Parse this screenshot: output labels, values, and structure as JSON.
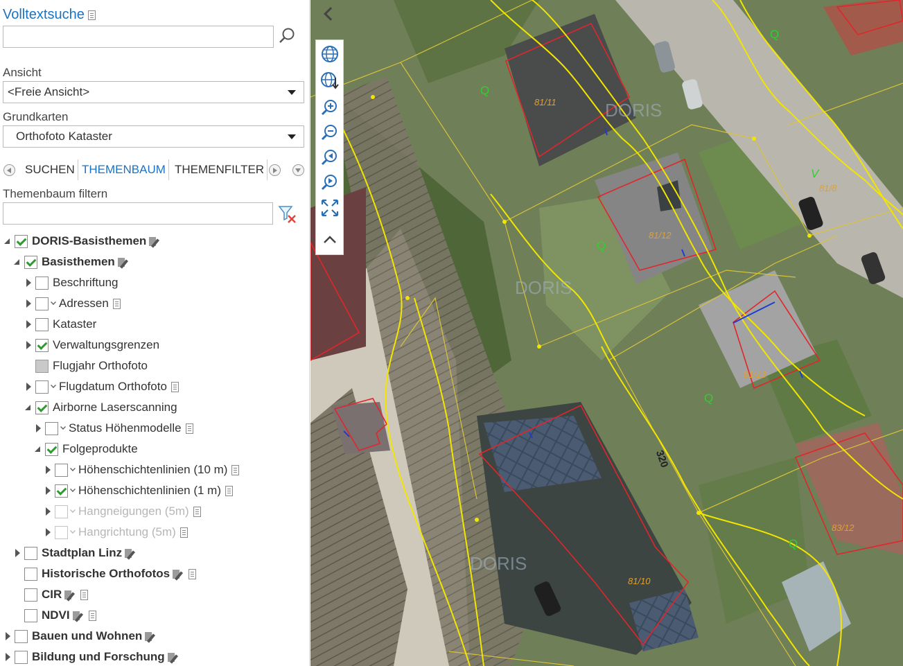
{
  "search": {
    "title": "Volltextsuche",
    "value": "",
    "placeholder": ""
  },
  "view": {
    "label": "Ansicht",
    "selected": "<Freie Ansicht>"
  },
  "basemap": {
    "label": "Grundkarten",
    "selected": "Orthofoto Kataster"
  },
  "tabs": [
    {
      "label": "SUCHEN"
    },
    {
      "label": "THEMENBAUM"
    },
    {
      "label": "THEMENFILTER"
    }
  ],
  "filter": {
    "label": "Themenbaum filtern",
    "value": "",
    "placeholder": ""
  },
  "tree": [
    {
      "label": "DORIS-Basisthemen",
      "bold": true,
      "toggle": "expanded",
      "check": "checked",
      "icons": [
        "edit"
      ]
    },
    {
      "label": "Basisthemen",
      "bold": true,
      "toggle": "expanded",
      "check": "checked",
      "icons": [
        "edit"
      ]
    },
    {
      "label": "Beschriftung",
      "toggle": "collapsed",
      "check": "unchecked",
      "icons": []
    },
    {
      "label": "Adressen",
      "toggle": "collapsed",
      "check": "unchecked",
      "chevron": true,
      "icons": [
        "info"
      ]
    },
    {
      "label": "Kataster",
      "toggle": "collapsed",
      "check": "unchecked",
      "icons": []
    },
    {
      "label": "Verwaltungsgrenzen",
      "toggle": "collapsed",
      "check": "checked",
      "icons": []
    },
    {
      "label": "Flugjahr Orthofoto",
      "toggle": "none",
      "check": "partial",
      "icons": []
    },
    {
      "label": "Flugdatum Orthofoto",
      "toggle": "collapsed",
      "check": "unchecked",
      "chevron": true,
      "icons": [
        "info"
      ]
    },
    {
      "label": "Airborne Laserscanning",
      "toggle": "expanded",
      "check": "checked",
      "icons": []
    },
    {
      "label": "Status Höhenmodelle",
      "toggle": "collapsed",
      "check": "unchecked",
      "chevron": true,
      "icons": [
        "info"
      ]
    },
    {
      "label": "Folgeprodukte",
      "toggle": "expanded",
      "check": "checked",
      "icons": []
    },
    {
      "label": "Höhenschichtenlinien (10 m)",
      "toggle": "collapsed",
      "check": "unchecked",
      "chevron": true,
      "icons": [
        "info"
      ]
    },
    {
      "label": "Höhenschichtenlinien (1 m)",
      "toggle": "collapsed",
      "check": "checked",
      "chevron": true,
      "icons": [
        "info"
      ]
    },
    {
      "label": "Hangneigungen (5m)",
      "toggle": "collapsed",
      "check": "unchecked",
      "chevron": true,
      "disabled": true,
      "icons": [
        "info"
      ]
    },
    {
      "label": "Hangrichtung (5m)",
      "toggle": "collapsed",
      "check": "unchecked",
      "chevron": true,
      "disabled": true,
      "icons": [
        "info"
      ]
    },
    {
      "label": "Stadtplan Linz",
      "bold": true,
      "toggle": "collapsed",
      "check": "unchecked",
      "icons": [
        "edit"
      ]
    },
    {
      "label": "Historische Orthofotos",
      "bold": true,
      "toggle": "none",
      "check": "unchecked",
      "icons": [
        "edit",
        "info"
      ]
    },
    {
      "label": "CIR",
      "bold": true,
      "toggle": "none",
      "check": "unchecked",
      "icons": [
        "edit",
        "info"
      ]
    },
    {
      "label": "NDVI",
      "bold": true,
      "toggle": "none",
      "check": "unchecked",
      "icons": [
        "edit",
        "info"
      ]
    },
    {
      "label": "Bauen und Wohnen",
      "bold": true,
      "toggle": "collapsed",
      "check": "unchecked",
      "icons": [
        "edit"
      ]
    },
    {
      "label": "Bildung und Forschung",
      "bold": true,
      "toggle": "collapsed",
      "check": "unchecked",
      "icons": [
        "edit"
      ]
    }
  ],
  "map": {
    "parcels": [
      "81/11",
      "81/12",
      "81/13",
      "81/10",
      "83/12",
      "81/8"
    ],
    "q_label": "Q",
    "v_label": "V",
    "contour_label": "320",
    "watermark": "DORIS"
  },
  "toolbar": [
    "globe-icon",
    "globe-refresh-icon",
    "zoom-in-icon",
    "zoom-out-icon",
    "zoom-previous-icon",
    "zoom-next-icon",
    "full-extent-icon",
    "collapse-up-icon"
  ],
  "colors": {
    "accent": "#1a73c2",
    "check": "#2f9a2f",
    "parcel_border": "#e0262b",
    "contour": "#f2e600",
    "cadastre": "#d9c23a"
  }
}
